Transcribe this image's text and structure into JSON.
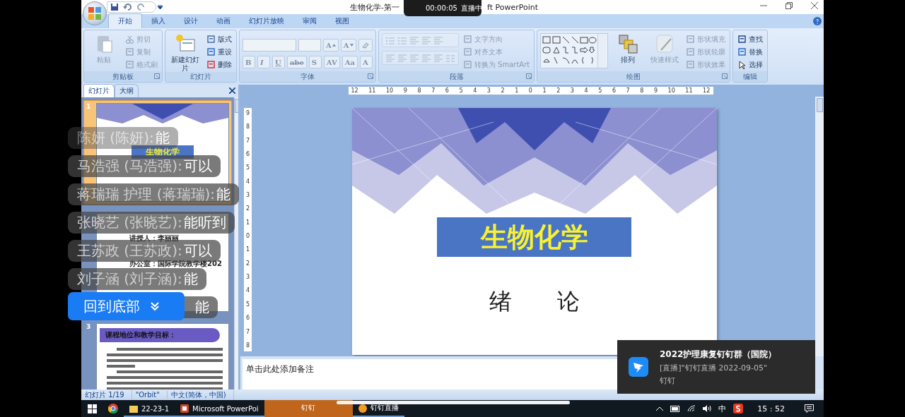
{
  "window": {
    "title_start": "生物化学-第一",
    "title_end": "ft PowerPoint"
  },
  "live": {
    "time": "00:00:05",
    "status": "直播中"
  },
  "tabs": [
    {
      "label": "开始",
      "selected": true
    },
    {
      "label": "插入",
      "selected": false
    },
    {
      "label": "设计",
      "selected": false
    },
    {
      "label": "动画",
      "selected": false
    },
    {
      "label": "幻灯片放映",
      "selected": false
    },
    {
      "label": "审阅",
      "selected": false
    },
    {
      "label": "视图",
      "selected": false
    }
  ],
  "ribbon": [
    {
      "label": "剪贴板",
      "launcher": true,
      "kind": "columns",
      "lines": [
        [
          {
            "kind": "big",
            "label": "粘贴",
            "disabled": true
          }
        ],
        [
          {
            "kind": "small",
            "label": "剪切",
            "disabled": true
          },
          {
            "kind": "small",
            "label": "复制",
            "disabled": true
          },
          {
            "kind": "small",
            "label": "格式刷",
            "disabled": true
          }
        ]
      ]
    },
    {
      "label": "幻灯片",
      "launcher": false,
      "kind": "columns",
      "lines": [
        [
          {
            "kind": "big",
            "label": "新建幻灯片",
            "disabled": false
          }
        ],
        [
          {
            "kind": "small",
            "label": "版式",
            "disabled": false
          },
          {
            "kind": "small",
            "label": "重设",
            "disabled": false
          },
          {
            "kind": "small",
            "label": "删除",
            "disabled": false
          }
        ]
      ]
    },
    {
      "label": "字体",
      "launcher": true,
      "kind": "rows",
      "lines": [
        [
          {
            "kind": "field"
          },
          {
            "kind": "field"
          },
          {
            "kind": "glyph",
            "label": "A",
            "disabled": true
          },
          {
            "kind": "glyph",
            "label": "A",
            "disabled": true
          },
          {
            "kind": "clear",
            "disabled": true
          }
        ],
        [
          {
            "kind": "bold",
            "label": "B",
            "disabled": true
          },
          {
            "kind": "italic",
            "label": "I",
            "disabled": true
          },
          {
            "kind": "underline",
            "label": "U",
            "disabled": true
          },
          {
            "kind": "strike",
            "label": "abe",
            "disabled": true
          },
          {
            "kind": "glyph",
            "label": "S",
            "disabled": true
          },
          {
            "kind": "glyph",
            "label": "AV",
            "disabled": true
          },
          {
            "kind": "glyph",
            "label": "Aa",
            "disabled": true
          },
          {
            "kind": "glyph",
            "label": "A",
            "disabled": true
          }
        ]
      ]
    },
    {
      "label": "段落",
      "launcher": true,
      "kind": "columns",
      "lines": [
        [
          {
            "kind": "strip",
            "disabled": true
          },
          {
            "kind": "strip",
            "disabled": true
          }
        ],
        [
          {
            "kind": "small",
            "label": "文字方向",
            "disabled": true
          },
          {
            "kind": "small",
            "label": "对齐文本",
            "disabled": true
          },
          {
            "kind": "small",
            "label": "转换为 SmartArt",
            "disabled": true
          }
        ]
      ]
    },
    {
      "label": "绘图",
      "launcher": true,
      "kind": "columns",
      "lines": [
        [
          {
            "kind": "gallery"
          }
        ],
        [
          {
            "kind": "big",
            "label": "排列",
            "disabled": false
          }
        ],
        [
          {
            "kind": "big",
            "label": "快速样式",
            "disabled": true
          }
        ],
        [
          {
            "kind": "small",
            "label": "形状填充",
            "disabled": true
          },
          {
            "kind": "small",
            "label": "形状轮廓",
            "disabled": true
          },
          {
            "kind": "small",
            "label": "形状效果",
            "disabled": true
          }
        ]
      ]
    },
    {
      "label": "编辑",
      "launcher": false,
      "kind": "columns",
      "lines": [
        [
          {
            "kind": "small",
            "label": "查找",
            "disabled": false
          },
          {
            "kind": "small",
            "label": "替换",
            "disabled": false
          },
          {
            "kind": "small",
            "label": "选择",
            "disabled": false
          }
        ]
      ]
    }
  ],
  "panel": {
    "tabs": [
      {
        "label": "幻灯片",
        "selected": true
      },
      {
        "label": "大纲",
        "selected": false
      }
    ],
    "slides": [
      {
        "number": "1",
        "selected": true,
        "kind": "title",
        "title": "生物化学"
      },
      {
        "selected": false,
        "kind": "contact",
        "lines": [
          "讲授人：李丽丽",
          "办公室：国际学院教学楼202"
        ]
      },
      {
        "number": "3",
        "selected": false,
        "kind": "text",
        "title": "课程地位和教学目标："
      }
    ]
  },
  "ruler": {
    "horizontal": [
      "12",
      "11",
      "10",
      "9",
      "8",
      "7",
      "6",
      "5",
      "4",
      "3",
      "2",
      "1",
      "0",
      "1",
      "2",
      "3",
      "4",
      "5",
      "6",
      "7",
      "8",
      "9",
      "10",
      "11",
      "12"
    ],
    "vertical": [
      "9",
      "8",
      "7",
      "6",
      "5",
      "4",
      "3",
      "2",
      "1",
      "0",
      "1",
      "2",
      "3",
      "4",
      "5",
      "6",
      "7",
      "8"
    ]
  },
  "slide": {
    "title": "生物化学",
    "subtitle": "绪　　论"
  },
  "notes": {
    "placeholder": "单击此处添加备注"
  },
  "status_bar": [
    "幻灯片 1/19",
    "\"Orbit\"",
    "中文(简体，中国)"
  ],
  "chat": [
    {
      "name": "陈妍 (陈妍):",
      "message": "能",
      "faded": true
    },
    {
      "name": "马浩强 (马浩强):",
      "message": "可以",
      "faded": false
    },
    {
      "name": "蒋瑞瑞 护理 (蒋瑞瑞):",
      "message": "能",
      "faded": false
    },
    {
      "name": "张晓艺 (张晓艺):",
      "message": "能听到",
      "faded": false
    },
    {
      "name": "王苏政 (王苏政):",
      "message": "可以",
      "faded": false
    },
    {
      "name": "刘子涵 (刘子涵):",
      "message": "能",
      "faded": false
    },
    {
      "message": "能",
      "faded": false
    }
  ],
  "back_to_bottom": "回到底部",
  "notification": {
    "title": "2022护理康复钉钉群（国院）",
    "body": "[直播]\"钉钉直播 2022-09-05\"",
    "source": "钉钉"
  },
  "taskbar": {
    "items": [
      {
        "label": "22-23-1",
        "kind": "folder",
        "selected": false
      },
      {
        "label": "Microsoft PowerPoi",
        "kind": "ppt",
        "selected": false
      },
      {
        "label": "钉钉",
        "kind": "plain",
        "selected": true
      },
      {
        "label": "钉钉直播",
        "kind": "live",
        "selected": false
      }
    ],
    "ime": "中",
    "time": "15 : 52"
  }
}
